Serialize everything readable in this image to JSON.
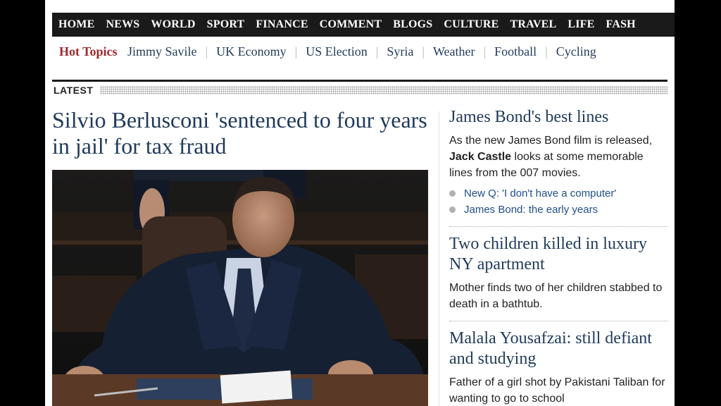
{
  "nav": {
    "items": [
      "HOME",
      "NEWS",
      "WORLD",
      "SPORT",
      "FINANCE",
      "COMMENT",
      "BLOGS",
      "CULTURE",
      "TRAVEL",
      "LIFE",
      "FASH"
    ]
  },
  "hot_topics": {
    "label": "Hot Topics",
    "items": [
      "Jimmy Savile",
      "UK Economy",
      "US Election",
      "Syria",
      "Weather",
      "Football",
      "Cycling"
    ]
  },
  "latest": {
    "label": "LATEST"
  },
  "main_story": {
    "headline": "Silvio Berlusconi 'sentenced to four years in jail' for tax fraud"
  },
  "sidebar": {
    "story1": {
      "title": "James Bond's best lines",
      "summary_before": "As the new James Bond film is released, ",
      "summary_bold": "Jack Castle",
      "summary_after": " looks at some memorable lines from the 007 movies.",
      "related": [
        "New Q: 'I don't have a computer'",
        "James Bond: the early years"
      ]
    },
    "story2": {
      "title": "Two children killed in luxury NY apartment",
      "summary": "Mother finds two of her children stabbed to death in a bathtub."
    },
    "story3": {
      "title": "Malala Yousafzai: still defiant and studying",
      "summary": "Father of a girl shot by Pakistani Taliban for wanting to go to school"
    }
  }
}
